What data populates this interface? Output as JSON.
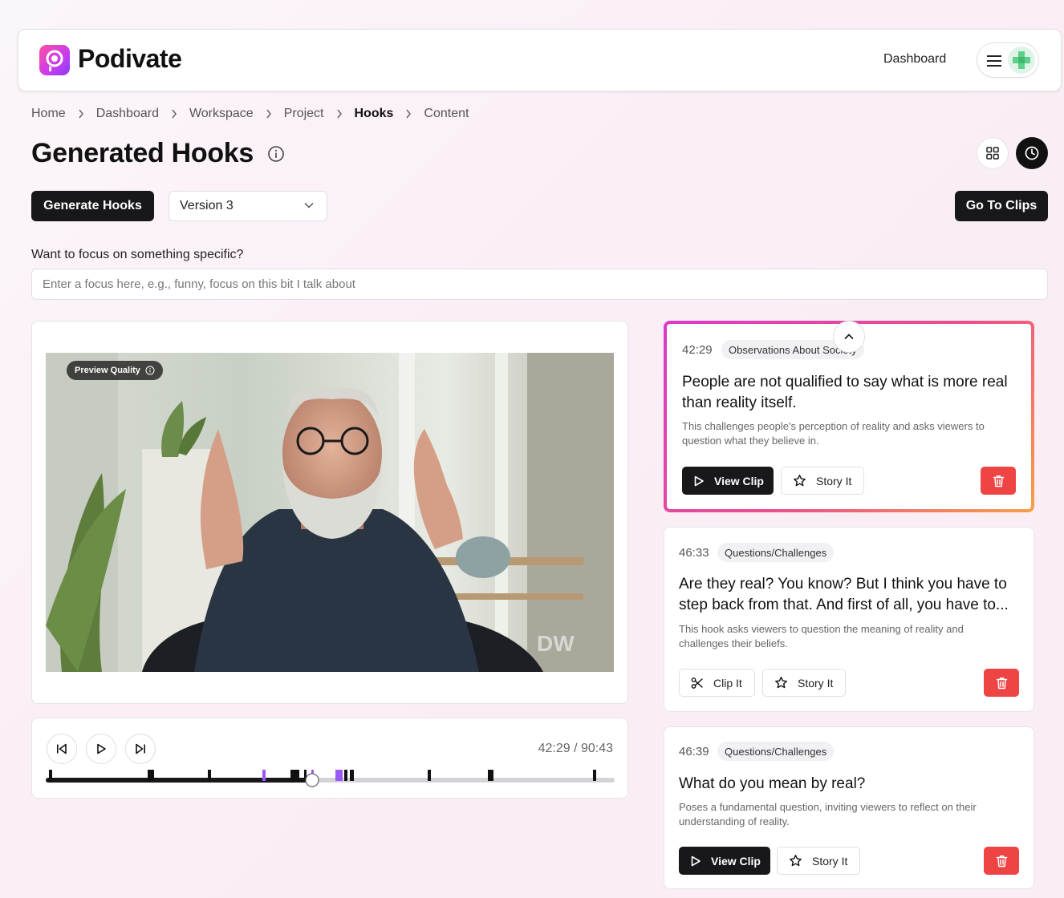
{
  "app": {
    "name": "Podivate"
  },
  "nav": {
    "dashboard_label": "Dashboard"
  },
  "breadcrumb": [
    "Home",
    "Dashboard",
    "Workspace",
    "Project",
    "Hooks",
    "Content"
  ],
  "page": {
    "title": "Generated Hooks"
  },
  "toolbar": {
    "generate_label": "Generate Hooks",
    "version_value": "Version 3",
    "goto_clips_label": "Go To Clips"
  },
  "focus": {
    "label": "Want to focus on something specific?",
    "placeholder": "Enter a focus here, e.g., funny, focus on this bit I talk about"
  },
  "video": {
    "preview_label": "Preview Quality",
    "watermark": "DW"
  },
  "player": {
    "current_time": "42:29",
    "total_time": "90:43",
    "time_readout": "42:29 / 90:43",
    "progress": 0.468
  },
  "hooks": [
    {
      "time": "42:29",
      "tag": "Observations About Society",
      "title": "People are not qualified to say what is more real than reality itself.",
      "description": "This challenges people's perception of reality and asks viewers to question what they believe in.",
      "primary_label": "View Clip",
      "story_label": "Story It"
    },
    {
      "time": "46:33",
      "tag": "Questions/Challenges",
      "title": "Are they real? You know? But I think you have to step back from that. And first of all, you have to...",
      "description": "This hook asks viewers to question the meaning of reality and challenges their beliefs.",
      "primary_label": "Clip It",
      "story_label": "Story It"
    },
    {
      "time": "46:39",
      "tag": "Questions/Challenges",
      "title": "What do you mean by real?",
      "description": "Poses a fundamental question, inviting viewers to reflect on their understanding of reality.",
      "primary_label": "View Clip",
      "story_label": "Story It"
    }
  ],
  "colors": {
    "accent_dark": "#18181b",
    "delete_red": "#ef4444",
    "marker_purple": "#9b59f5",
    "active_gradient": [
      "#d93ac8",
      "#ec4f8a",
      "#f6a04a"
    ]
  },
  "icons": {
    "info": "info-icon",
    "grid": "grid-icon",
    "history": "clock-icon",
    "prev": "skip-back-icon",
    "play": "play-icon",
    "next": "skip-forward-icon",
    "scissors": "scissors-icon",
    "star": "star-icon",
    "trash": "trash-icon"
  }
}
